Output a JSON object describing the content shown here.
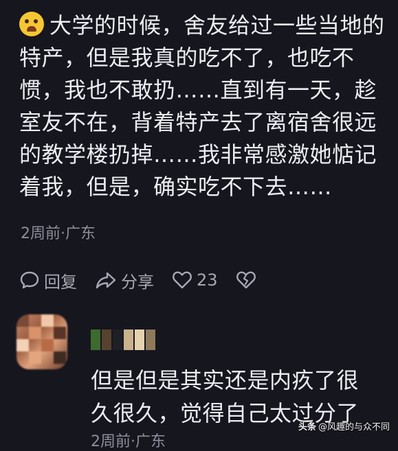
{
  "comment": {
    "emoji": "crying-laughing-emoji",
    "text": "大学的时候，舍友给过一些当地的特产，但是我真的吃不了，也吃不惯，我也不敢扔……直到有一天，趁室友不在，背着特产去了离宿舍很远的教学楼扔掉……我非常感激她惦记着我，但是，确实吃不下去……",
    "meta": "2周前·广东"
  },
  "actions": {
    "reply_label": "回复",
    "share_label": "分享",
    "like_count": "23"
  },
  "reply": {
    "text": "但是但是其实还是内疚了很久很久，觉得自己太过分了",
    "meta_partial": "2周前·广东"
  },
  "watermark": {
    "brand": "头条",
    "handle": "@风趣的与众不同"
  },
  "colors": {
    "background": "#16161e",
    "text": "#ececf2",
    "meta": "#8e8e9a",
    "icon": "#a8a8b4"
  }
}
